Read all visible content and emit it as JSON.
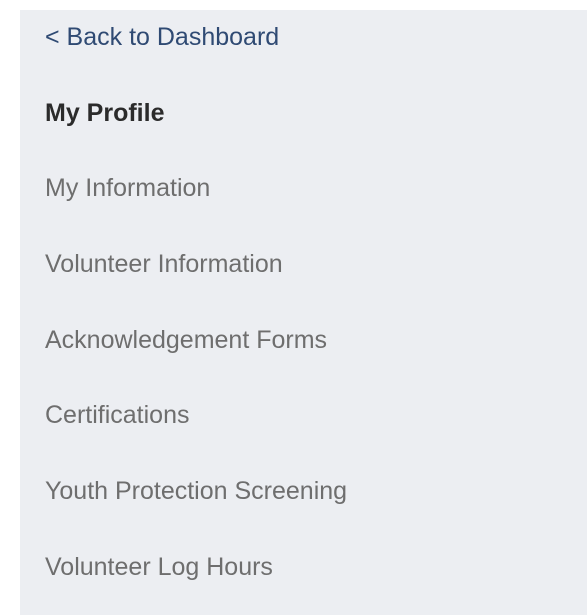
{
  "sidebar": {
    "back_link": "< Back to Dashboard",
    "section_title": "My Profile",
    "items": [
      {
        "label": "My Information"
      },
      {
        "label": "Volunteer Information"
      },
      {
        "label": "Acknowledgement Forms"
      },
      {
        "label": "Certifications"
      },
      {
        "label": "Youth Protection Screening"
      },
      {
        "label": "Volunteer Log Hours"
      }
    ]
  },
  "colors": {
    "panel_background": "#eceef2",
    "back_link": "#2f4a73",
    "section_title": "#2b2b2b",
    "menu_item": "#6e6e6e"
  }
}
